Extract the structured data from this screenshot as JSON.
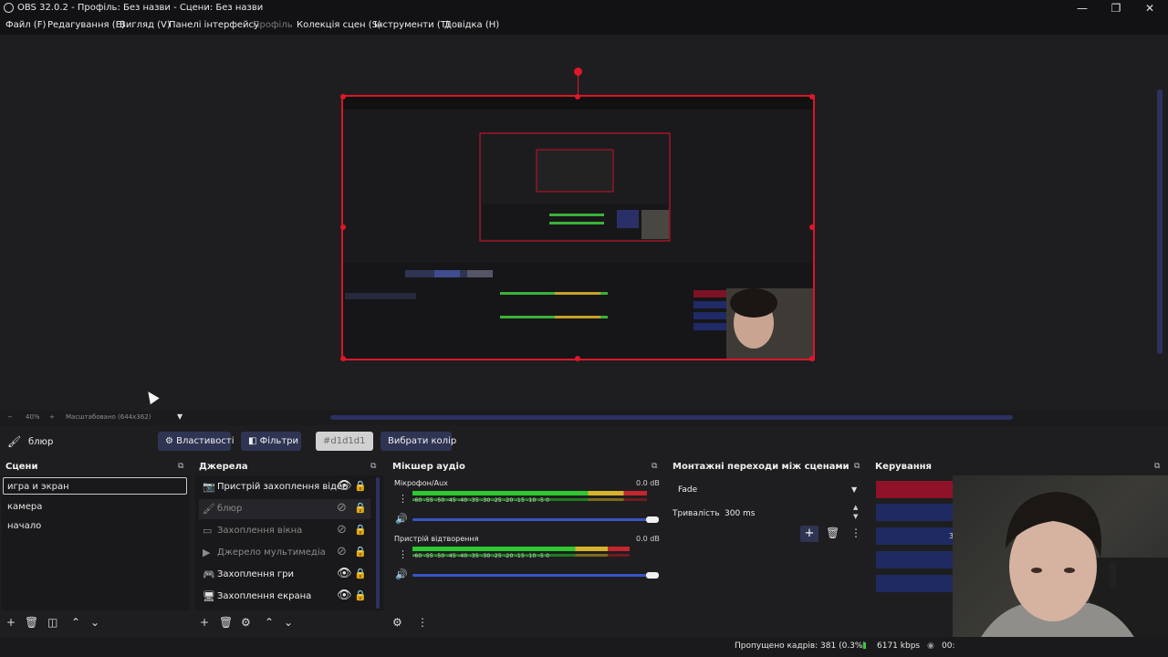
{
  "window": {
    "title": "OBS 32.0.2 - Профіль: Без назви - Сцени: Без назви",
    "minimize": "—",
    "restore": "❐",
    "close": "✕"
  },
  "menu": {
    "items": [
      {
        "label": "Файл (F)",
        "enabled": true
      },
      {
        "label": "Редагування (E)",
        "enabled": true
      },
      {
        "label": "Вигляд (V)",
        "enabled": true
      },
      {
        "label": "Панелі інтерфейсу",
        "enabled": true
      },
      {
        "label": "Профіль",
        "enabled": false
      },
      {
        "label": "Колекція сцен (S)",
        "enabled": true
      },
      {
        "label": "Інструменти (T)",
        "enabled": true
      },
      {
        "label": "Довідка (H)",
        "enabled": true
      }
    ]
  },
  "zoom": {
    "minus": "−",
    "level": "40%",
    "plus": "+",
    "mode": "Масштабовано (644x362)"
  },
  "source_toolbar": {
    "selected_source": "блюр",
    "properties": "Властивості",
    "filters": "Фільтри",
    "color_value": "#d1d1d1",
    "pick_color": "Вибрати колір"
  },
  "scenes": {
    "title": "Сцени",
    "items": [
      "игра и экран",
      "камера",
      "начало"
    ],
    "selected": 0
  },
  "sources": {
    "title": "Джерела",
    "items": [
      {
        "label": "Пристрій захоплення відео",
        "icon": "camera-icon",
        "visible": true
      },
      {
        "label": "блюр",
        "icon": "brush-icon",
        "visible": false
      },
      {
        "label": "Захоплення вікна",
        "icon": "window-icon",
        "visible": false
      },
      {
        "label": "Джерело мультимедіа",
        "icon": "play-icon",
        "visible": false
      },
      {
        "label": "Захоплення гри",
        "icon": "gamepad-icon",
        "visible": true
      },
      {
        "label": "Захоплення екрана",
        "icon": "monitor-icon",
        "visible": true
      }
    ]
  },
  "mixer": {
    "title": "Мікшер аудіо",
    "channels": [
      {
        "name": "Мікрофон/Aux",
        "db": "0.0 dB",
        "level": 0.95
      },
      {
        "name": "Пристрій відтворення",
        "db": "0.0 dB",
        "level": 0.88
      }
    ],
    "scale": "-60 -55 -50 -45 -40 -35 -30 -25 -20 -15 -10 -5 0"
  },
  "transitions": {
    "title": "Монтажні переходи між сценами",
    "type": "Fade",
    "duration_label": "Тривалість",
    "duration_value": "300 ms"
  },
  "controls": {
    "title": "Керування",
    "badge": "3"
  },
  "status": {
    "dropped": "Пропущено кадрів: 381 (0.3%)",
    "bitrate": "6171 kbps",
    "time": "00:"
  },
  "colors": {
    "accent": "#2f3453",
    "selection": "#e0162a",
    "control_red": "#8f1228",
    "control_blue": "#1f2a63"
  }
}
